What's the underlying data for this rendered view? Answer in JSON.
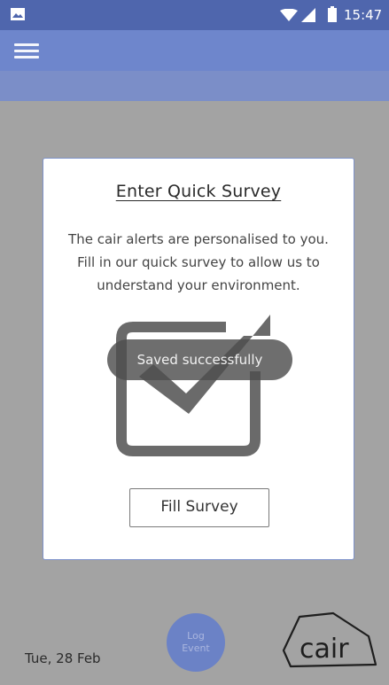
{
  "status_bar": {
    "time": "15:47",
    "icons": [
      "gallery-icon",
      "wifi-icon",
      "signal-icon",
      "battery-icon"
    ]
  },
  "app_bar": {
    "menu_icon": "hamburger-menu-icon"
  },
  "card": {
    "title": "Enter Quick Survey",
    "body": "The cair alerts are personalised to you. Fill in our quick survey to allow us to understand your environment.",
    "graphic_icon": "checkbox-check-icon",
    "button_label": "Fill Survey"
  },
  "toast": {
    "message": "Saved successfully"
  },
  "footer": {
    "date": "Tue, 28 Feb",
    "log_event_line1": "Log",
    "log_event_line2": "Event",
    "logo_text": "cair"
  },
  "colors": {
    "status_bar": "#4f66ad",
    "app_bar": "#6e86cc",
    "background": "#a3a3a3",
    "accent": "#6b82c6"
  }
}
